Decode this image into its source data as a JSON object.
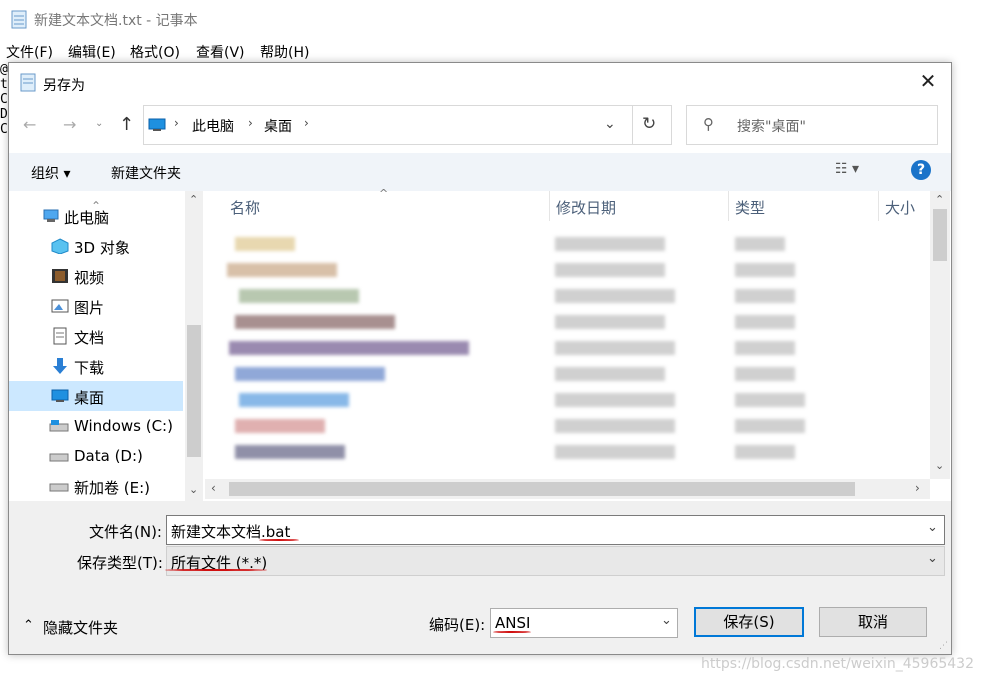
{
  "notepad": {
    "title": "新建文本文档.txt - 记事本",
    "menu": [
      "文件(F)",
      "编辑(E)",
      "格式(O)",
      "查看(V)",
      "帮助(H)"
    ],
    "text_lines": [
      "@",
      "t",
      "C",
      "D",
      "C"
    ]
  },
  "dialog": {
    "title": "另存为",
    "close": "✕",
    "address": [
      "此电脑",
      "桌面"
    ],
    "search_placeholder": "搜索\"桌面\"",
    "toolbar": {
      "organize": "组织 ▾",
      "new_folder": "新建文件夹"
    },
    "nav_items": [
      {
        "label": "此电脑",
        "icon": "computer-icon"
      },
      {
        "label": "3D 对象",
        "icon": "cube-icon"
      },
      {
        "label": "视频",
        "icon": "video-icon"
      },
      {
        "label": "图片",
        "icon": "picture-icon"
      },
      {
        "label": "文档",
        "icon": "document-icon"
      },
      {
        "label": "下载",
        "icon": "download-icon"
      },
      {
        "label": "桌面",
        "icon": "desktop-icon",
        "selected": true
      },
      {
        "label": "Windows (C:)",
        "icon": "drive-icon"
      },
      {
        "label": "Data (D:)",
        "icon": "drive-icon"
      },
      {
        "label": "新加卷 (E:)",
        "icon": "drive-icon"
      }
    ],
    "columns": [
      "名称",
      "修改日期",
      "类型",
      "大小"
    ],
    "filename_label": "文件名(N):",
    "filename_value": "新建文本文档.bat",
    "filetype_label": "保存类型(T):",
    "filetype_value": "所有文件  (*.*)",
    "hide_folders": "隐藏文件夹",
    "encoding_label": "编码(E):",
    "encoding_value": "ANSI",
    "save": "保存(S)",
    "cancel": "取消"
  },
  "watermark": "https://blog.csdn.net/weixin_45965432",
  "colors": {
    "selection": "#cce8ff",
    "accent": "#0078d7",
    "annotation": "#d01010"
  }
}
